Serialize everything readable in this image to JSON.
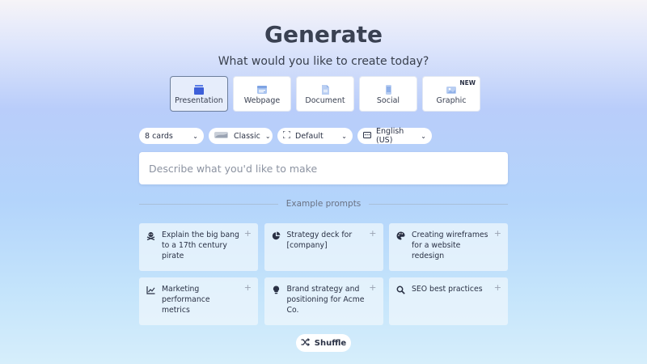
{
  "header": {
    "title": "Generate",
    "subtitle": "What would you like to create today?"
  },
  "content_types": [
    {
      "label": "Presentation",
      "icon": "presentation-icon",
      "selected": true
    },
    {
      "label": "Webpage",
      "icon": "webpage-icon"
    },
    {
      "label": "Document",
      "icon": "document-icon"
    },
    {
      "label": "Social",
      "icon": "social-icon"
    },
    {
      "label": "Graphic",
      "icon": "graphic-icon",
      "badge": "NEW"
    }
  ],
  "options": {
    "cards": "8 cards",
    "theme": "Classic",
    "layout": "Default",
    "language": "English (US)"
  },
  "prompt": {
    "placeholder": "Describe what you'd like to make",
    "value": ""
  },
  "examples": {
    "heading": "Example prompts",
    "items": [
      {
        "text": "Explain the big bang to a 17th century pirate",
        "icon": "pirate-icon"
      },
      {
        "text": "Strategy deck for [company]",
        "icon": "pie-chart-icon"
      },
      {
        "text": "Creating wireframes for a website redesign",
        "icon": "palette-icon"
      },
      {
        "text": "Marketing performance metrics",
        "icon": "line-chart-icon"
      },
      {
        "text": "Brand strategy and positioning for Acme Co.",
        "icon": "lightbulb-icon"
      },
      {
        "text": "SEO best practices",
        "icon": "search-icon"
      }
    ]
  },
  "shuffle_label": "Shuffle",
  "colors": {
    "accent": "#3d5fd9",
    "text": "#2a3145",
    "selected_border": "#6d7f9c"
  }
}
